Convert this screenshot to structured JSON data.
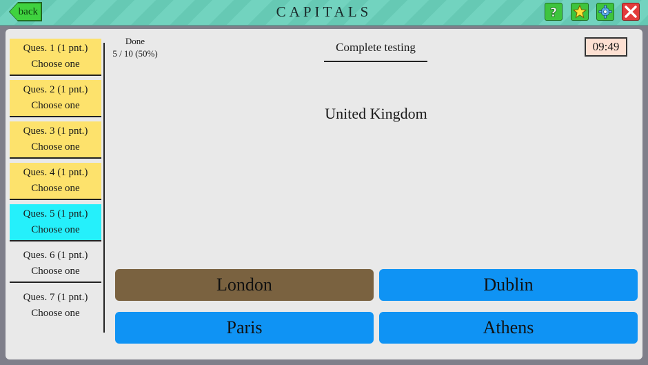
{
  "header": {
    "title": "CAPITALS",
    "back_label": "back",
    "tools": [
      "help-icon",
      "star-icon",
      "gear-icon",
      "close-icon"
    ]
  },
  "sidebar": {
    "items": [
      {
        "title": "Ques. 1 (1 pnt.)",
        "subtitle": "Choose one",
        "state": "done"
      },
      {
        "title": "Ques. 2 (1 pnt.)",
        "subtitle": "Choose one",
        "state": "done"
      },
      {
        "title": "Ques. 3 (1 pnt.)",
        "subtitle": "Choose one",
        "state": "done"
      },
      {
        "title": "Ques. 4 (1 pnt.)",
        "subtitle": "Choose one",
        "state": "done"
      },
      {
        "title": "Ques. 5 (1 pnt.)",
        "subtitle": "Choose one",
        "state": "current"
      },
      {
        "title": "Ques. 6 (1 pnt.)",
        "subtitle": "Choose one",
        "state": "pending"
      },
      {
        "title": "Ques. 7 (1 pnt.)",
        "subtitle": "Choose one",
        "state": "pending"
      }
    ]
  },
  "progress": {
    "label": "Done",
    "value": "5 / 10 (50%)"
  },
  "complete_label": "Complete testing",
  "timer": "09:49",
  "question": "United Kingdom",
  "answers": [
    {
      "label": "London",
      "selected": true
    },
    {
      "label": "Dublin",
      "selected": false
    },
    {
      "label": "Paris",
      "selected": false
    },
    {
      "label": "Athens",
      "selected": false
    }
  ],
  "colors": {
    "header_bg": "#6dcfba",
    "done_item": "#fde26c",
    "current_item": "#25f0fb",
    "answer_default": "#0f93f4",
    "answer_selected": "#7a6240",
    "timer_bg": "#fde0d2"
  }
}
